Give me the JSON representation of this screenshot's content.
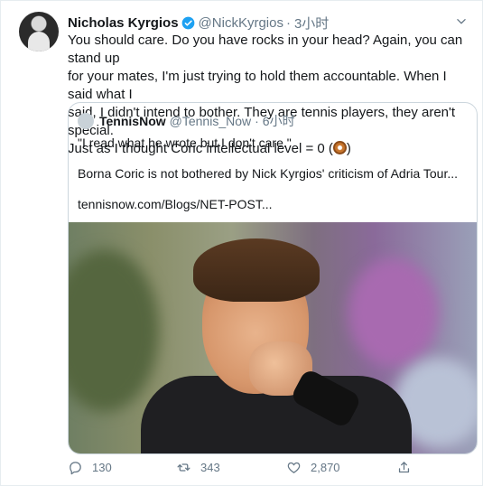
{
  "tweet": {
    "author_name": "Nicholas Kyrgios",
    "author_handle": "@NickKyrgios",
    "separator": "·",
    "time": "3小时",
    "lines": [
      "You should care. Do you have rocks in your head? Again, you can stand up",
      "for your mates, I'm just trying to hold them accountable. When I said what I",
      "said, I didn't intend to bother. They are tennis players, they aren't special.",
      "Just as I thought Coric intellectual level = 0 ("
    ],
    "line4_end": ")"
  },
  "quote": {
    "author_name": "TennisNow",
    "author_handle": "@Tennis_Now",
    "separator": "·",
    "time": "6小时",
    "line1": "\"I read what he wrote but I don't care.\"",
    "line2": "Borna Coric is not bothered by Nick Kyrgios' criticism of Adria Tour...",
    "link": "tennisnow.com/Blogs/NET-POST..."
  },
  "actions": {
    "reply_count": "130",
    "retweet_count": "343",
    "like_count": "2,870"
  },
  "colors": {
    "verified": "#1da1f2",
    "muted": "#657786",
    "text": "#14171a"
  },
  "icons": [
    "verified-badge-icon",
    "chevron-down-icon",
    "reply-icon",
    "retweet-icon",
    "like-icon",
    "share-icon",
    "donut-emoji-icon"
  ]
}
